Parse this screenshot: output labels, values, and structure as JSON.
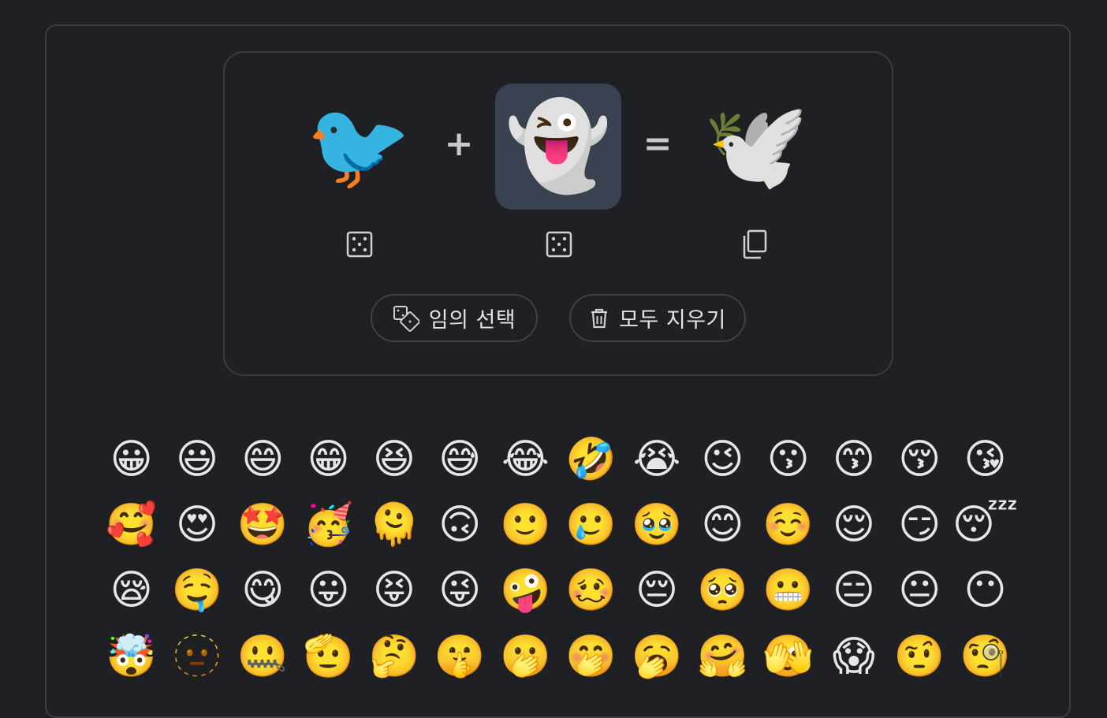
{
  "mixer": {
    "left_emoji": "🐦",
    "operator_plus": "+",
    "right_emoji": "👻",
    "operator_equals": "=",
    "result_emoji": "🕊️"
  },
  "actions": {
    "random_label": "임의 선택",
    "clear_label": "모두 지우기"
  },
  "emoji_grid": [
    "😀",
    "😃",
    "😄",
    "😁",
    "😆",
    "😅",
    "😂",
    "🤣",
    "😭",
    "😉",
    "😗",
    "😙",
    "😚",
    "😘",
    "🥰",
    "😍",
    "🤩",
    "🥳",
    "🫠",
    "🙃",
    "🙂",
    "🥲",
    "🥹",
    "😊",
    "☺️",
    "😌",
    "😏",
    "😴",
    "😪",
    "🤤",
    "😋",
    "😛",
    "😝",
    "😜",
    "🤪",
    "🥴",
    "😔",
    "🥺",
    "😬",
    "😑",
    "😐",
    "😶",
    "🤯",
    "🫥",
    "🤐",
    "🫡",
    "🤔",
    "🤫",
    "🫢",
    "🤭",
    "🥱",
    "🤗",
    "🫣",
    "😱",
    "🤨",
    "🧐"
  ],
  "colors": {
    "background": "#1f2024",
    "border": "#3b3c42",
    "selected_slot": "#3a4150"
  }
}
